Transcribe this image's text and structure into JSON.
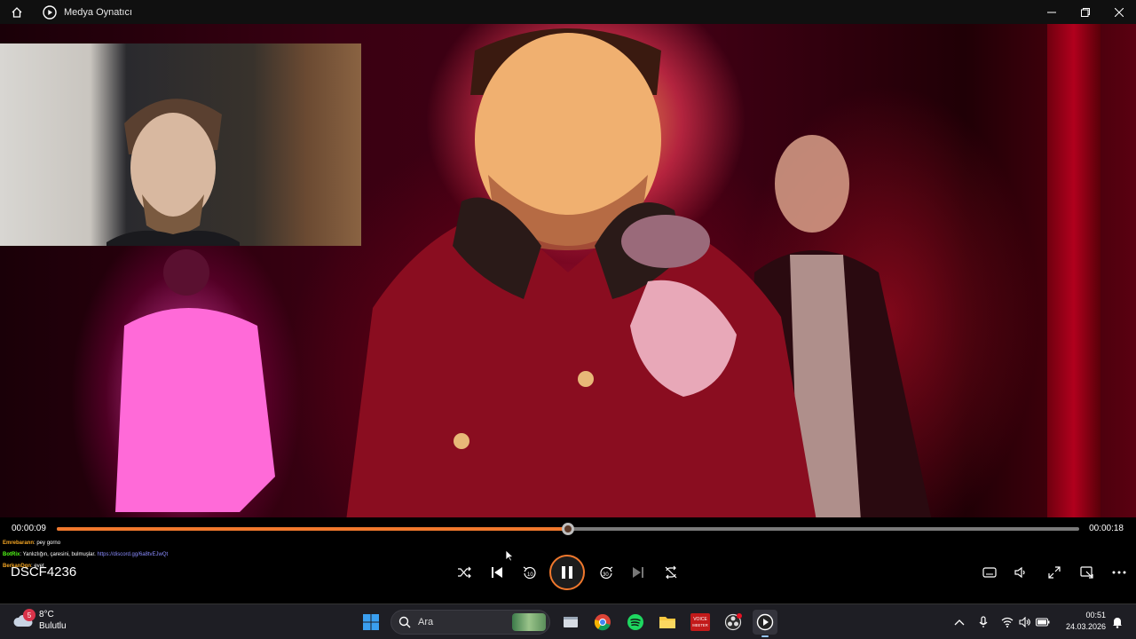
{
  "window": {
    "title": "Medya Oynatıcı",
    "icons": {
      "home": "home-icon",
      "app": "media-player-icon",
      "minimize": "minimize-icon",
      "maximize": "maximize-icon",
      "close": "close-icon"
    }
  },
  "player": {
    "current_time": "00:00:09",
    "total_time": "00:00:18",
    "progress": 0.5,
    "media_title": "DSCF4236",
    "accent_color": "#f0782d",
    "state": "playing"
  },
  "chat": [
    {
      "user": "Emrebarann",
      "user_color": "#f5a623",
      "message": ": pey gorno",
      "link": ""
    },
    {
      "user": "BotRix",
      "user_color": "#53fc18",
      "message": ": Yanlızlığın, çaresini, bulmuşlar.",
      "link": "https://discord.gg/6a8tvEJwQt"
    },
    {
      "user": "BerkanDgn",
      "user_color": "#f5a623",
      "message": ": evet",
      "link": ""
    }
  ],
  "controls": {
    "left": [
      "shuffle-icon",
      "previous-icon",
      "rewind-10-icon",
      "pause-icon",
      "forward-30-icon",
      "next-icon",
      "repeat-off-icon"
    ],
    "right": [
      "subtitles-icon",
      "volume-icon",
      "fullscreen-icon",
      "mini-player-icon",
      "more-icon"
    ],
    "rewind_label": "10",
    "forward_label": "30"
  },
  "taskbar": {
    "weather": {
      "badge": "5",
      "temp": "8°C",
      "condition": "Bulutlu"
    },
    "search_placeholder": "Ara",
    "apps": [
      "windows-start-icon",
      "file-explorer-window-icon",
      "chrome-icon",
      "spotify-icon",
      "folder-icon",
      "voicemeeter-icon",
      "obs-icon",
      "media-player-icon"
    ],
    "voicemeeter_label": "VOICE MEETER",
    "clock": {
      "time": "00:51",
      "date": "24.03.2026"
    },
    "tray": [
      "chevron-up-icon",
      "microphone-icon",
      "wifi-icon",
      "speaker-icon",
      "battery-icon",
      "notification-icon"
    ]
  }
}
